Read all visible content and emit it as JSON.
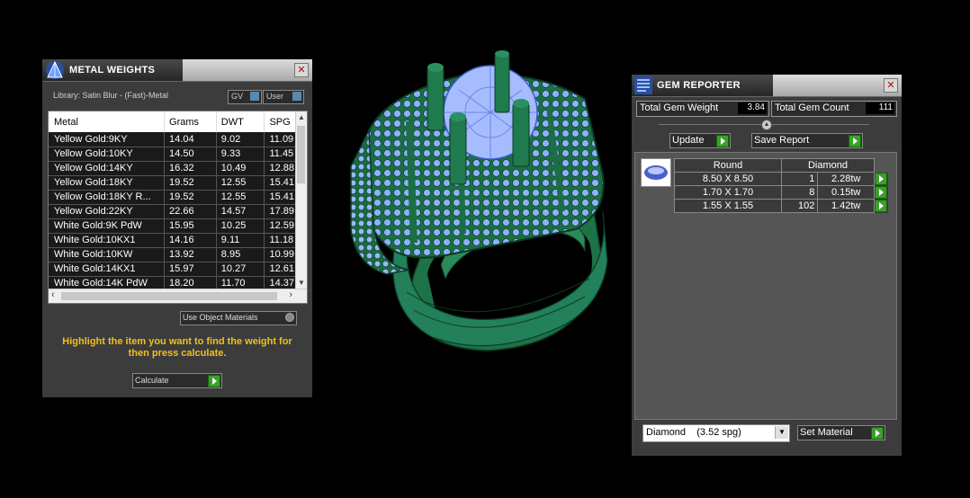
{
  "metal_weights": {
    "title": "METAL WEIGHTS",
    "library_label": "Library: Satin Blur - (Fast)-Metal",
    "gv_label": "GV",
    "user_label": "User",
    "columns": [
      "Metal",
      "Grams",
      "DWT",
      "SPG"
    ],
    "rows": [
      [
        "Yellow Gold:9KY",
        "14.04",
        "9.02",
        "11.09"
      ],
      [
        "Yellow Gold:10KY",
        "14.50",
        "9.33",
        "11.45"
      ],
      [
        "Yellow Gold:14KY",
        "16.32",
        "10.49",
        "12.88"
      ],
      [
        "Yellow Gold:18KY",
        "19.52",
        "12.55",
        "15.41"
      ],
      [
        "Yellow Gold:18KY R...",
        "19.52",
        "12.55",
        "15.41"
      ],
      [
        "Yellow Gold:22KY",
        "22.66",
        "14.57",
        "17.89"
      ],
      [
        "White Gold:9K PdW",
        "15.95",
        "10.25",
        "12.59"
      ],
      [
        "White Gold:10KX1",
        "14.16",
        "9.11",
        "11.18"
      ],
      [
        "White Gold:10KW",
        "13.92",
        "8.95",
        "10.99"
      ],
      [
        "White Gold:14KX1",
        "15.97",
        "10.27",
        "12.61"
      ],
      [
        "White Gold:14K PdW",
        "18.20",
        "11.70",
        "14.37"
      ]
    ],
    "use_object_materials": "Use Object Materials",
    "instruction": "Highlight the item you want to find the weight for then press calculate.",
    "calculate_label": "Calculate"
  },
  "gem_reporter": {
    "title": "GEM REPORTER",
    "total_weight_label": "Total Gem Weight",
    "total_weight_value": "3.84",
    "total_count_label": "Total Gem Count",
    "total_count_value": "111",
    "update_label": "Update",
    "save_report_label": "Save Report",
    "header": [
      "Round",
      "Diamond"
    ],
    "rows": [
      [
        "8.50 X 8.50",
        "1",
        "2.28tw"
      ],
      [
        "1.70 X 1.70",
        "8",
        "0.15tw"
      ],
      [
        "1.55 X 1.55",
        "102",
        "1.42tw"
      ]
    ],
    "material_select": "Diamond    (3.52 spg)",
    "set_material_label": "Set Material"
  },
  "colors": {
    "ring_green": "#1f7a4e",
    "gem_blue": "#8fb0ff",
    "accent_green": "#3aa02a",
    "instruction_yellow": "#f0c020"
  }
}
